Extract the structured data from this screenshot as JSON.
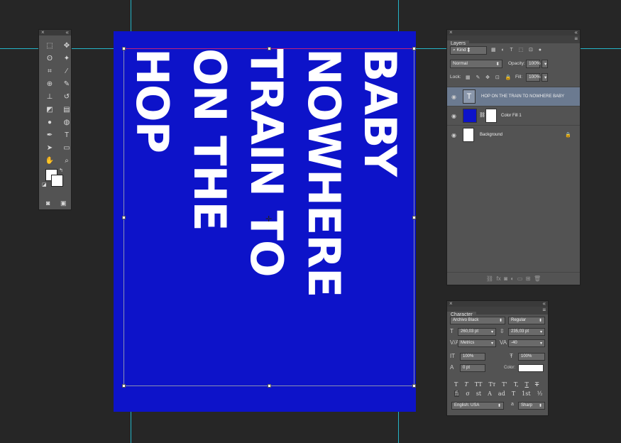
{
  "canvas": {
    "background": "#0d13c9",
    "text_color": "#ffffff",
    "columns": [
      "HOP",
      "ON THE",
      "TRAIN TO",
      "NOWHERE",
      "BABY"
    ]
  },
  "layers_panel": {
    "tab_label": "Layers",
    "filter_label": "Kind",
    "blend_mode": "Normal",
    "opacity_label": "Opacity:",
    "opacity_value": "100%",
    "lock_label": "Lock:",
    "fill_label": "Fill:",
    "fill_value": "100%",
    "layers": [
      {
        "name": "HOP ON THE TRAIN TO NOWHERE BABY",
        "type": "text",
        "selected": true
      },
      {
        "name": "Color Fill 1",
        "type": "fill",
        "selected": false
      },
      {
        "name": "Background",
        "type": "background",
        "selected": false
      }
    ]
  },
  "character_panel": {
    "tab_label": "Character",
    "font_family": "Archivo Black",
    "font_style": "Regular",
    "font_size": "260,03 pt",
    "leading": "235,03 pt",
    "kerning": "Metrics",
    "tracking": "-40",
    "vertical_scale": "100%",
    "horizontal_scale": "100%",
    "baseline_shift": "0 pt",
    "color_label": "Color:",
    "color_value": "#ffffff",
    "language": "English: USA",
    "antialias": "Sharp",
    "aa_label": "a",
    "glyphs": [
      "T",
      "T",
      "TT",
      "Tт",
      "T'",
      "T,",
      "T",
      "T"
    ],
    "opentype_glyphs": [
      "fi",
      "σ",
      "st",
      "A",
      "ad",
      "T",
      "1st",
      "½"
    ]
  },
  "icons": [
    "marquee-icon",
    "move-icon",
    "lasso-icon",
    "magic-wand-icon",
    "crop-icon",
    "eyedropper-icon",
    "healing-icon",
    "brush-icon",
    "stamp-icon",
    "history-brush-icon",
    "eraser-icon",
    "gradient-icon",
    "blur-icon",
    "dodge-icon",
    "pen-icon",
    "type-icon",
    "path-select-icon",
    "rectangle-icon",
    "hand-icon",
    "zoom-icon"
  ]
}
